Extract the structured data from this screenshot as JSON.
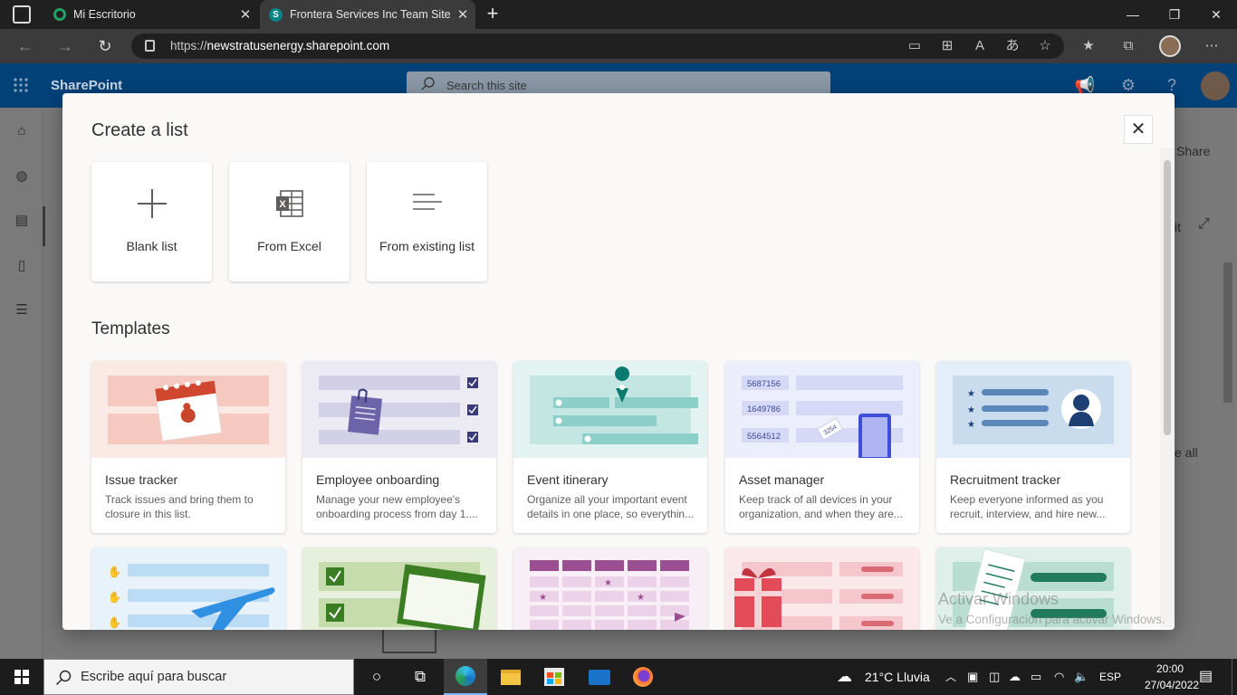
{
  "browser": {
    "tabs": [
      {
        "title": "Mi Escritorio",
        "icon": "green-circle-icon"
      },
      {
        "title": "Frontera Services Inc Team Site -",
        "icon": "sharepoint-icon"
      }
    ],
    "url_scheme": "https://",
    "url_host": "newstratusenergy.sharepoint.com"
  },
  "sharepoint": {
    "app_name": "SharePoint",
    "search_placeholder": "Search this site",
    "share_label": "Share",
    "edit_fragment": "it",
    "see_all_fragment": "e all"
  },
  "modal": {
    "title": "Create a list",
    "options": [
      {
        "label": "Blank list",
        "icon": "plus-icon"
      },
      {
        "label": "From Excel",
        "icon": "excel-icon"
      },
      {
        "label": "From existing list",
        "icon": "lines-icon"
      }
    ],
    "templates_heading": "Templates",
    "templates": [
      {
        "title": "Issue tracker",
        "desc": "Track issues and bring them to closure in this list."
      },
      {
        "title": "Employee onboarding",
        "desc": "Manage your new employee's onboarding process from day 1...."
      },
      {
        "title": "Event itinerary",
        "desc": "Organize all your important event details in one place, so everythin..."
      },
      {
        "title": "Asset manager",
        "desc": "Keep track of all devices in your organization, and when they are..."
      },
      {
        "title": "Recruitment tracker",
        "desc": "Keep everyone informed as you recruit, interview, and hire new..."
      }
    ],
    "asset_numbers": [
      "5687156",
      "1649786",
      "5564512"
    ],
    "asset_tag": "3254"
  },
  "watermark": {
    "line1": "Activar Windows",
    "line2": "Ve a Configuración para activar Windows."
  },
  "taskbar": {
    "search_placeholder": "Escribe aquí para buscar",
    "weather": "21°C  Lluvia",
    "language": "ESP",
    "time": "20:00",
    "date": "27/04/2022"
  },
  "colors": {
    "sharepoint_blue": "#0078d4",
    "teal": "#038387"
  }
}
